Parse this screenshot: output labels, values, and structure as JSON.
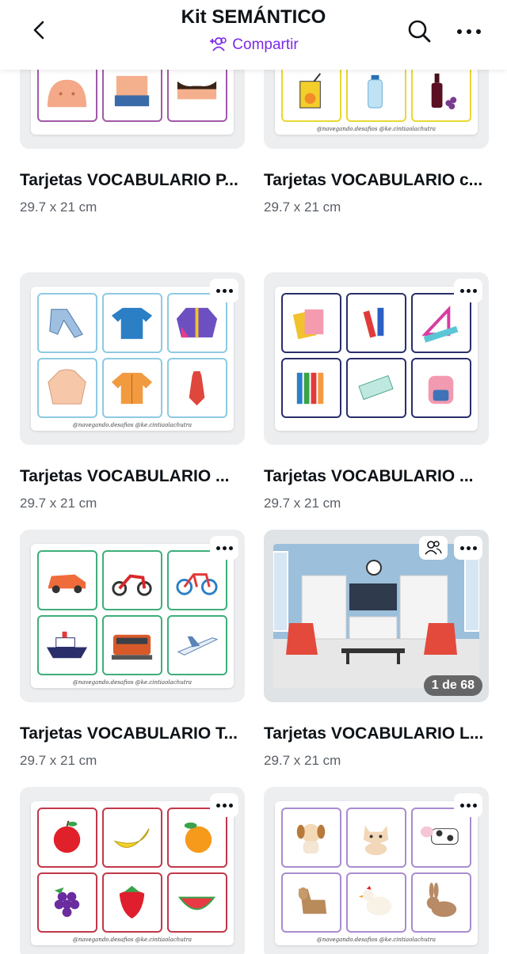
{
  "header": {
    "title": "Kit SEMÁNTICO",
    "share_label": "Compartir"
  },
  "cards": [
    {
      "name": "Tarjetas VOCABULARIO P...",
      "size": "29.7 x 21 cm",
      "border": "#a05aa8"
    },
    {
      "name": "Tarjetas VOCABULARIO c...",
      "size": "29.7 x 21 cm",
      "border": "#e8d832"
    },
    {
      "name": "Tarjetas VOCABULARIO ...",
      "size": "29.7 x 21 cm",
      "border": "#8ecbe3",
      "credits": "@navegando.desafios   @ke.cintiaolachutra"
    },
    {
      "name": "Tarjetas VOCABULARIO ...",
      "size": "29.7 x 21 cm",
      "border": "#2a2f6b"
    },
    {
      "name": "Tarjetas VOCABULARIO T...",
      "size": "29.7 x 21 cm",
      "border": "#3fae7a",
      "credits": "@navegando.desafios   @ke.cintiaolachutra"
    },
    {
      "name": "Tarjetas VOCABULARIO L...",
      "size": "29.7 x 21 cm",
      "page_badge": "1 de 68"
    },
    {
      "name": "",
      "size": "",
      "border": "#c0384a",
      "credits": "@navegando.desafios   @ke.cintiaolachutra"
    },
    {
      "name": "",
      "size": "",
      "border": "#a98ccf",
      "credits": "@navegando.desafios   @ke.cintiaolachutra"
    }
  ],
  "colors": {
    "accent": "#7d2ae8",
    "text": "#0e1318",
    "subtext": "#5a6068"
  }
}
